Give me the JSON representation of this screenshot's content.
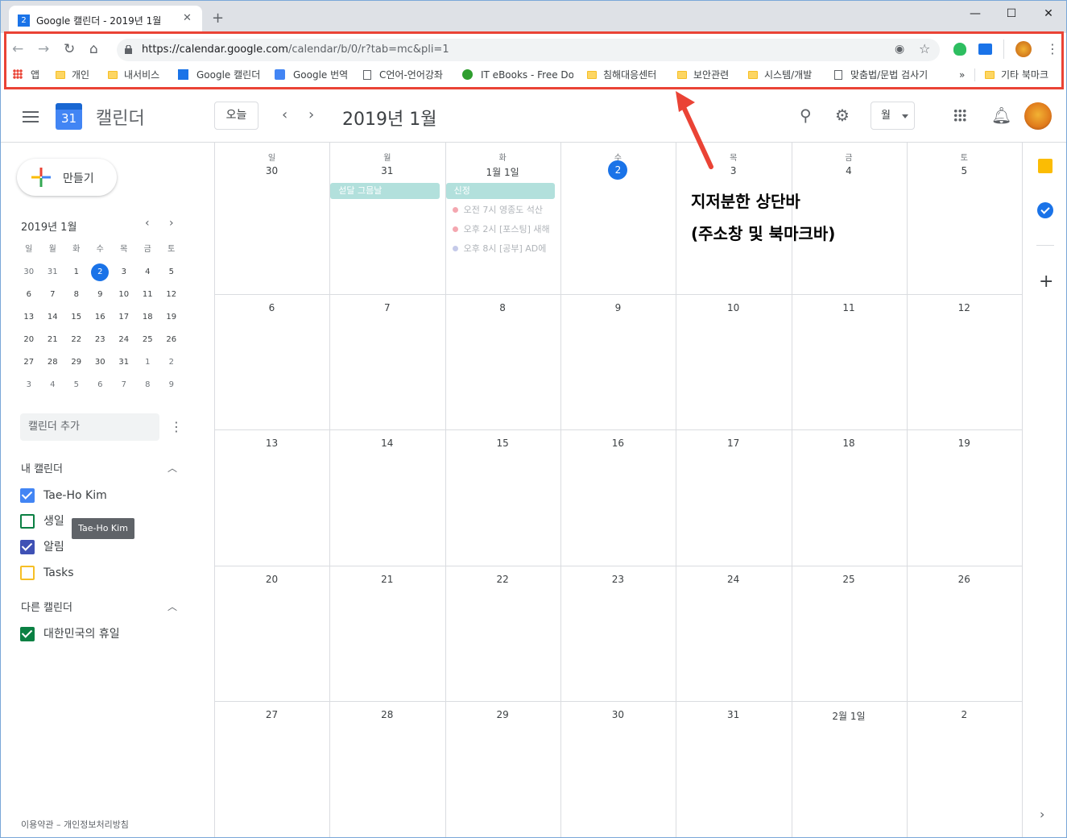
{
  "browser": {
    "tab_title": "Google 캘린더 - 2019년 1월",
    "tab_favicon": "2",
    "tab_close": "✕",
    "new_tab": "+",
    "minimize": "—",
    "maximize": "☐",
    "close": "✕",
    "url_host": "https://calendar.google.com",
    "url_path": "/calendar/b/0/r?tab=mc&pli=1",
    "bookmarks": [
      {
        "label": "앱",
        "icon": "apps-icon"
      },
      {
        "label": "개인",
        "icon": "folder-icon"
      },
      {
        "label": "내서비스",
        "icon": "folder-icon"
      },
      {
        "label": "Google 캘린더",
        "icon": "calendar-favicon"
      },
      {
        "label": "Google 번역",
        "icon": "translate-favicon"
      },
      {
        "label": "C언어-언어강좌",
        "icon": "page-icon"
      },
      {
        "label": "IT eBooks - Free Do",
        "icon": "ebooks-favicon"
      },
      {
        "label": "침해대응센터",
        "icon": "folder-icon"
      },
      {
        "label": "보안관련",
        "icon": "folder-icon"
      },
      {
        "label": "시스템/개발",
        "icon": "folder-icon"
      },
      {
        "label": "맞춤법/문법 검사기",
        "icon": "page-icon"
      }
    ],
    "more_bookmarks": "»",
    "other_bookmarks": "기타 북마크"
  },
  "header": {
    "app_name": "캘린더",
    "logo_day": "31",
    "today_button": "오늘",
    "month_title": "2019년 1월",
    "view_select": "월"
  },
  "sidebar": {
    "create_label": "만들기",
    "mini_title": "2019년 1월",
    "mini_weekdays": [
      "일",
      "월",
      "화",
      "수",
      "목",
      "금",
      "토"
    ],
    "mini_weeks": [
      [
        "30",
        "31",
        "1",
        "2",
        "3",
        "4",
        "5"
      ],
      [
        "6",
        "7",
        "8",
        "9",
        "10",
        "11",
        "12"
      ],
      [
        "13",
        "14",
        "15",
        "16",
        "17",
        "18",
        "19"
      ],
      [
        "20",
        "21",
        "22",
        "23",
        "24",
        "25",
        "26"
      ],
      [
        "27",
        "28",
        "29",
        "30",
        "31",
        "1",
        "2"
      ],
      [
        "3",
        "4",
        "5",
        "6",
        "7",
        "8",
        "9"
      ]
    ],
    "add_calendar_placeholder": "캘린더 추가",
    "my_calendars_title": "내 캘린더",
    "my_calendars": [
      {
        "label": "Tae-Ho Kim",
        "color": "#4285f4",
        "checked": true
      },
      {
        "label": "생일",
        "color": "#0b8043",
        "checked": false
      },
      {
        "label": "알림",
        "color": "#3f51b5",
        "checked": true
      },
      {
        "label": "Tasks",
        "color": "#f6bf26",
        "checked": false
      }
    ],
    "tooltip": "Tae-Ho Kim",
    "other_calendars_title": "다른 캘린더",
    "other_calendars": [
      {
        "label": "대한민국의 휴일",
        "color": "#0b8043",
        "checked": true
      }
    ],
    "footer": "이용약관 – 개인정보처리방침"
  },
  "grid": {
    "weekdays": [
      "일",
      "월",
      "화",
      "수",
      "목",
      "금",
      "토"
    ],
    "weeks": [
      [
        "30",
        "31",
        "1월 1일",
        "2",
        "3",
        "4",
        "5"
      ],
      [
        "6",
        "7",
        "8",
        "9",
        "10",
        "11",
        "12"
      ],
      [
        "13",
        "14",
        "15",
        "16",
        "17",
        "18",
        "19"
      ],
      [
        "20",
        "21",
        "22",
        "23",
        "24",
        "25",
        "26"
      ],
      [
        "27",
        "28",
        "29",
        "30",
        "31",
        "2월 1일",
        "2"
      ]
    ],
    "today_label": "2",
    "allday_events": [
      {
        "label": "섣달 그믐날"
      },
      {
        "label": "신정"
      }
    ],
    "timed_events": [
      {
        "label": "오전 7시 영종도 석산",
        "color": "#f4a7b0"
      },
      {
        "label": "오후 2시 [포스팅] 새해",
        "color": "#f4a7b0"
      },
      {
        "label": "오후 8시 [공부] AD에",
        "color": "#c5cae9"
      }
    ]
  },
  "annotation": {
    "line1": "지저분한 상단바",
    "line2": "(주소창 및 북마크바)",
    "color": "#ea4335"
  }
}
